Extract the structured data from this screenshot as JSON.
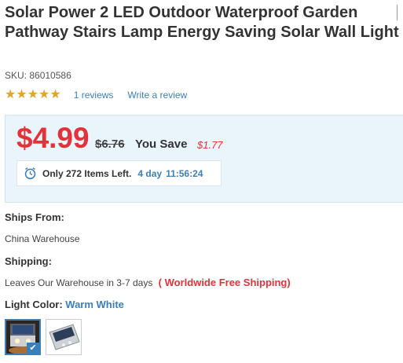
{
  "product": {
    "title": "Solar Power 2 LED Outdoor Waterproof Garden Pathway Stairs Lamp Energy Saving Solar Wall Light",
    "sku_label": "SKU:",
    "sku": "86010586",
    "rating_stars": 5,
    "reviews_link": "1 reviews",
    "write_review_link": "Write a review"
  },
  "pricing": {
    "price": "$4.99",
    "old_price": "$6.76",
    "you_save_label": "You Save",
    "save_amount": "$1.77",
    "items_left": "Only 272 Items Left.",
    "days": "4 day",
    "countdown": "11:56:24"
  },
  "shipping": {
    "ships_from_label": "Ships From:",
    "ships_from_value": "China Warehouse",
    "shipping_label": "Shipping:",
    "shipping_time": "Leaves Our Warehouse in 3-7 days",
    "free_shipping": "( Worldwide Free Shipping)"
  },
  "options": {
    "light_color_label": "Light Color:",
    "light_color_value": "Warm White",
    "swatches": [
      "Warm White",
      "White"
    ]
  },
  "colors": {
    "price_red": "#e2323a",
    "link_blue": "#3a7fb8",
    "star_gold": "#e6a32a",
    "price_box_bg": "#eaf4fb"
  }
}
